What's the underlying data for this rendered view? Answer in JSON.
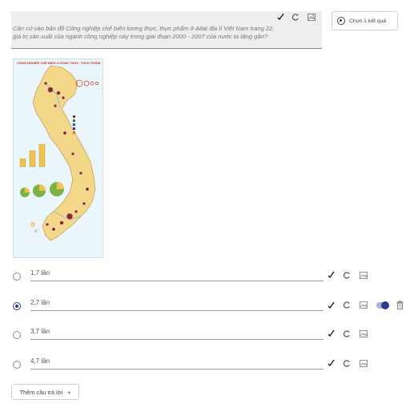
{
  "question": {
    "text": "Căn cứ vào bản đồ Công nghiệp chế biến lương thực, thực phẩm ở Atlat địa lí Việt Nam trang 22, giá trị sản xuất của ngành công nghiệp này trong giai đoạn 2000 - 2007 của nước ta tăng gần?"
  },
  "question_type": {
    "label": "Chọn 1 kết quả"
  },
  "map": {
    "title": "CÔNG NGHIỆP CHẾ BIẾN LƯƠNG THỰC, THỰC PHẨM"
  },
  "options": [
    {
      "value": "1,7 lần",
      "selected": false
    },
    {
      "value": "2,7 lần",
      "selected": true
    },
    {
      "value": "3,7 lần",
      "selected": false
    },
    {
      "value": "4,7 lần",
      "selected": false
    }
  ],
  "add_answer": {
    "label": "Thêm câu trả lời",
    "icon": "+"
  }
}
